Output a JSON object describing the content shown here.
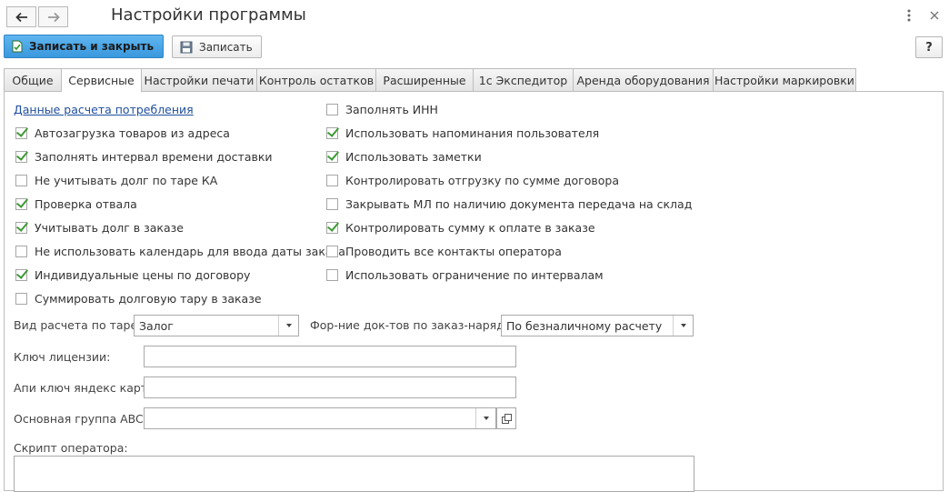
{
  "window": {
    "title": "Настройки программы",
    "back_icon": "arrow-left-icon",
    "forward_icon": "arrow-right-icon",
    "more_icon": "vertical-dots-icon",
    "close_icon": "close-icon"
  },
  "toolbar": {
    "save_close_label": "Записать и закрыть",
    "save_label": "Записать",
    "help_label": "?"
  },
  "tabs": [
    {
      "label": "Общие",
      "active": false
    },
    {
      "label": "Сервисные",
      "active": true
    },
    {
      "label": "Настройки печати",
      "active": false
    },
    {
      "label": "Контроль остатков",
      "active": false
    },
    {
      "label": "Расширенные",
      "active": false
    },
    {
      "label": "1с Экспедитор",
      "active": false
    },
    {
      "label": "Аренда оборудования",
      "active": false
    },
    {
      "label": "Настройки маркировки",
      "active": false
    }
  ],
  "panel": {
    "link_label": "Данные расчета потребления",
    "left_checkboxes": [
      {
        "label": "Автозагрузка товаров из адреса",
        "checked": true
      },
      {
        "label": "Заполнять интервал времени доставки",
        "checked": true
      },
      {
        "label": "Не учитывать долг по таре КА",
        "checked": false
      },
      {
        "label": "Проверка отвала",
        "checked": true
      },
      {
        "label": "Учитывать долг в заказе",
        "checked": true
      },
      {
        "label": "Не использовать календарь для ввода даты заказа",
        "checked": false
      },
      {
        "label": "Индивидуальные цены по договору",
        "checked": true
      },
      {
        "label": "Суммировать долговую тару в заказе",
        "checked": false
      }
    ],
    "right_checkboxes": [
      {
        "label": "Заполнять ИНН",
        "checked": false
      },
      {
        "label": "Использовать напоминания пользователя",
        "checked": true
      },
      {
        "label": "Использовать заметки",
        "checked": true
      },
      {
        "label": "Контролировать отгрузку по сумме договора",
        "checked": false
      },
      {
        "label": "Закрывать МЛ по наличию документа передача на склад",
        "checked": false
      },
      {
        "label": "Контролировать сумму к оплате в заказе",
        "checked": true
      },
      {
        "label": "Проводить все контакты оператора",
        "checked": false
      },
      {
        "label": "Использовать ограничение по интервалам",
        "checked": false
      }
    ],
    "tare_calc": {
      "label": "Вид расчета по таре:",
      "value": "Залог"
    },
    "doc_form": {
      "label": "Фор-ние док-тов по заказ-наряду :",
      "value": "По безналичному расчету"
    },
    "license_key": {
      "label": "Ключ лицензии:",
      "value": ""
    },
    "yandex_key": {
      "label": "Апи ключ яндекс карт:",
      "value": ""
    },
    "abc_group": {
      "label": "Основная группа ABC:",
      "value": ""
    },
    "operator_script": {
      "label": "Скрипт оператора:",
      "value": ""
    }
  },
  "colors": {
    "primary_button": "#3a98dd",
    "checkmark": "#3f9a36",
    "link": "#1f4e9e"
  }
}
